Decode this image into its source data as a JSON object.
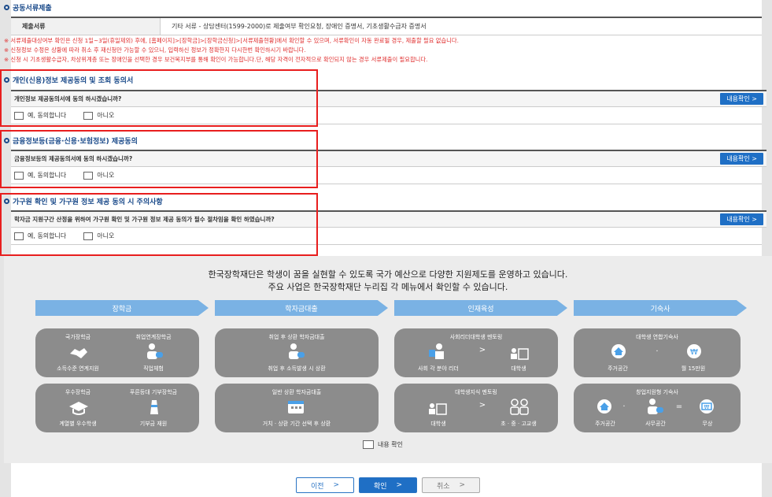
{
  "docs": {
    "title": "공동서류제출",
    "label": "제출서류",
    "value": "기타 서류 - 상담센터(1599-2000)로 제출여부 확인요청, 장애인 증명서, 기초생활수급자 증명서"
  },
  "notes": [
    "※ 서류제출대상여부 확인은 신청 1일~3일(휴일제외) 후에, [홈페이지]>[장학금]>[장학금신청]>[서류제출현황]에서 확인할 수 있으며, 서류확인이 자동 완료될 경우, 제출할 필요 없습니다.",
    "※ 신청정보 수정은 상황에 따라 취소 후 재신청만 가능할 수 있으니, 입력하신 정보가 정확한지 다시한번 확인하시기 바랍니다.",
    "※ 신청 시 기초생활수급자, 차상위계층 또는 장애인을 선택한 경우 보건복지부를 통해 확인이 가능합니다.단, 해당 자격이 전자적으로 확인되지 않는 경우 서류제출이 필요합니다."
  ],
  "consents": [
    {
      "title": "개인(신용)정보 제공동의 및 조회 동의서",
      "question": "개인정보 제공동의서에 동의 하시겠습니까?",
      "detail": "내용확인 >",
      "yes": "예, 동의합니다",
      "no": "아니오"
    },
    {
      "title": "금융정보등(금융·신용·보험정보) 제공동의",
      "question": "금융정보등의 제공동의서에 동의 하시겠습니까?",
      "detail": "내용확인 >",
      "yes": "예, 동의합니다",
      "no": "아니오"
    },
    {
      "title": "가구원 확인 및 가구원 정보 제공 동의 시 주의사항",
      "question": "학자금 지원구간 산정을 위하여 가구원 확인 및 가구원 정보 제공 동의가 필수 절차임을 확인 하였습니까?",
      "detail": "내용확인 >",
      "yes": "예, 동의합니다",
      "no": "아니오"
    }
  ],
  "intro": {
    "line1": "한국장학재단은 학생이 꿈을 실현할 수 있도록 국가 예산으로 다양한 지원제도를 운영하고 있습니다.",
    "line2": "주요 사업은 한국장학재단 누리집 각 메뉴에서 확인할 수 있습니다."
  },
  "programs": {
    "scholarship": {
      "banner": "장학금",
      "card1": {
        "t1": "국가장학금",
        "t2": "취업연계장학금",
        "b1": "소득수준 연계지원",
        "b2": "직업체험"
      },
      "card2": {
        "t1": "우수장학금",
        "t2": "푸른등대 기부장학금",
        "b1": "계열별 우수학생",
        "b2": "기부금 재원"
      }
    },
    "loan": {
      "banner": "학자금대출",
      "card1": {
        "t1": "취업 후 상환 학자금대출",
        "b1": "취업 후 소득발생 시 상환"
      },
      "card2": {
        "t1": "일반 상환 학자금대출",
        "b1": "거치 · 상환 기간 선택 후 상환"
      }
    },
    "talent": {
      "banner": "인재육성",
      "card1": {
        "t1": "사회리더대학생 멘토링",
        "b1": "사회 각 분야 리더",
        "b2": "대학생"
      },
      "card2": {
        "t1": "대학생지식 멘토링",
        "b1": "대학생",
        "b2": "초 · 중 · 고교생"
      }
    },
    "dorm": {
      "banner": "기숙사",
      "card1": {
        "t1": "대학생 연합기숙사",
        "b1": "주거공간",
        "b2": "월 15만원"
      },
      "card2": {
        "t1": "창업지원형 기숙사",
        "b1": "주거공간",
        "b2": "사무공간",
        "b3": "무상"
      }
    }
  },
  "confirm_label": "내용 확인",
  "footer": {
    "prev": "이전",
    "next": "확인",
    "cancel": "취소",
    "chevron": ">"
  },
  "colors": {
    "accent": "#1f6fc5",
    "note_red": "#e03030",
    "highlight_red": "#e81e1e",
    "banner_blue": "#7ab2e4",
    "card_gray": "#8c8c8c"
  }
}
